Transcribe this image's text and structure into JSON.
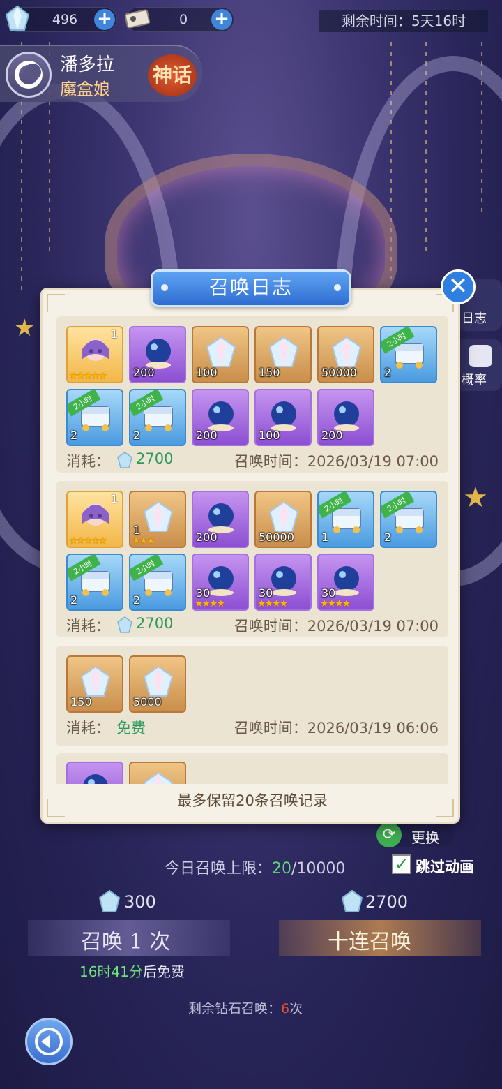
{
  "top_bar": {
    "crystals": "496",
    "tickets": "0",
    "remaining_time_label": "剩余时间：",
    "remaining_time_value": "5天16时"
  },
  "hero": {
    "name": "潘多拉",
    "subtitle": "魔盒娘",
    "rarity": "神话"
  },
  "side": {
    "log_label": "日志",
    "rate_label": "概率"
  },
  "background": {
    "change_label": "更换",
    "daily_limit_label": "今日召唤上限：",
    "daily_limit_current": "20",
    "daily_limit_max": "/10000",
    "skip_animation_label": "跳过动画",
    "single_cost": "300",
    "ten_cost": "2700",
    "single_button": "召唤 1 次",
    "ten_button": "十连召唤",
    "free_countdown": "16时41分",
    "free_suffix": "后免费",
    "remaining_diamond_label": "剩余钻石召唤：",
    "remaining_diamond_count": "6",
    "remaining_diamond_unit": "次"
  },
  "modal": {
    "title": "召唤日志",
    "footer": "最多保留20条召唤记录",
    "cost_label": "消耗：",
    "time_label": "召唤时间：",
    "records": [
      {
        "cost": "2700",
        "cost_type": "gem",
        "time": "2026/03/19 07:00",
        "items": [
          {
            "type": "hero",
            "qty": "",
            "stars": "★★★★★",
            "level": "1",
            "tag": ""
          },
          {
            "type": "purple",
            "qty": "200",
            "stars": "",
            "level": "",
            "tag": ""
          },
          {
            "type": "gold",
            "qty": "100",
            "stars": "",
            "level": "",
            "tag": ""
          },
          {
            "type": "gold",
            "qty": "150",
            "stars": "",
            "level": "",
            "tag": ""
          },
          {
            "type": "gold",
            "qty": "50000",
            "stars": "",
            "level": "",
            "tag": ""
          },
          {
            "type": "blue",
            "qty": "2",
            "stars": "",
            "level": "",
            "tag": "2小时"
          },
          {
            "type": "blue",
            "qty": "2",
            "stars": "",
            "level": "",
            "tag": "2小时"
          },
          {
            "type": "blue",
            "qty": "2",
            "stars": "",
            "level": "",
            "tag": "2小时"
          },
          {
            "type": "purple",
            "qty": "200",
            "stars": "",
            "level": "",
            "tag": ""
          },
          {
            "type": "purple",
            "qty": "100",
            "stars": "",
            "level": "",
            "tag": ""
          },
          {
            "type": "purple",
            "qty": "200",
            "stars": "",
            "level": "",
            "tag": ""
          }
        ]
      },
      {
        "cost": "2700",
        "cost_type": "gem",
        "time": "2026/03/19 07:00",
        "items": [
          {
            "type": "hero",
            "qty": "",
            "stars": "★★★★★",
            "level": "1",
            "tag": ""
          },
          {
            "type": "gold",
            "qty": "1",
            "stars": "★★★",
            "level": "",
            "tag": ""
          },
          {
            "type": "purple",
            "qty": "200",
            "stars": "",
            "level": "",
            "tag": ""
          },
          {
            "type": "gold",
            "qty": "50000",
            "stars": "",
            "level": "",
            "tag": ""
          },
          {
            "type": "blue",
            "qty": "1",
            "stars": "",
            "level": "",
            "tag": "2小时"
          },
          {
            "type": "blue",
            "qty": "2",
            "stars": "",
            "level": "",
            "tag": "2小时"
          },
          {
            "type": "blue",
            "qty": "2",
            "stars": "",
            "level": "",
            "tag": "2小时"
          },
          {
            "type": "blue",
            "qty": "2",
            "stars": "",
            "level": "",
            "tag": "2小时"
          },
          {
            "type": "purple",
            "qty": "30",
            "stars": "★★★★",
            "level": "",
            "tag": ""
          },
          {
            "type": "purple",
            "qty": "30",
            "stars": "★★★★",
            "level": "",
            "tag": ""
          },
          {
            "type": "purple",
            "qty": "30",
            "stars": "★★★★",
            "level": "",
            "tag": ""
          }
        ]
      },
      {
        "cost": "免费",
        "cost_type": "free",
        "time": "2026/03/19 06:06",
        "items": [
          {
            "type": "gold",
            "qty": "150",
            "stars": "",
            "level": "",
            "tag": ""
          },
          {
            "type": "gold",
            "qty": "5000",
            "stars": "",
            "level": "",
            "tag": ""
          }
        ]
      }
    ]
  },
  "colors": {
    "accent_blue": "#2f7fe0",
    "cost_green": "#2c9a5a",
    "panel_bg": "#f6f1e6"
  }
}
